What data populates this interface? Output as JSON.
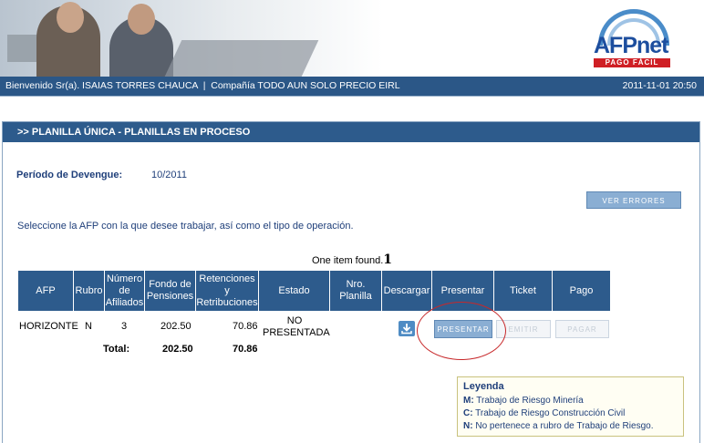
{
  "header": {
    "logo_name": "AFPnet",
    "logo_tagline": "PAGO FÁCIL"
  },
  "userbar": {
    "welcome": "Bienvenido Sr(a). ISAIAS TORRES CHAUCA  |  Compañía TODO AUN SOLO PRECIO EIRL",
    "datetime": "2011-11-01 20:50"
  },
  "panel": {
    "title": ">> PLANILLA ÚNICA - PLANILLAS EN PROCESO"
  },
  "periodo": {
    "label": "Período de Devengue:",
    "value": "10/2011"
  },
  "buttons": {
    "ver_errores": "VER ERRORES",
    "presentar": "PRESENTAR",
    "emitir": "EMITIR",
    "pagar": "PAGAR"
  },
  "instructions": "Seleccione la AFP con la que desee trabajar, así como el tipo de operación.",
  "table": {
    "found_text": "One item found.",
    "page_number": "1",
    "headers": {
      "afp": "AFP",
      "rubro": "Rubro",
      "afiliados": "Número de Afiliados",
      "fondo": "Fondo de Pensiones",
      "retenciones": "Retenciones y Retribuciones",
      "estado": "Estado",
      "planilla": "Nro. Planilla",
      "descargar": "Descargar",
      "presentar": "Presentar",
      "ticket": "Ticket",
      "pago": "Pago"
    },
    "row": {
      "afp": "HORIZONTE",
      "rubro": "N",
      "afiliados": "3",
      "fondo": "202.50",
      "retenciones": "70.86",
      "estado": "NO PRESENTADA"
    },
    "total": {
      "label": "Total:",
      "fondo": "202.50",
      "retenciones": "70.86"
    }
  },
  "legend": {
    "title": "Leyenda",
    "items": [
      {
        "code": "M:",
        "text": "Trabajo de Riesgo Minería"
      },
      {
        "code": "C:",
        "text": "Trabajo de Riesgo Construcción Civil"
      },
      {
        "code": "N:",
        "text": "No pertenece a rubro de Trabajo de Riesgo."
      }
    ]
  },
  "icons": {
    "download": "download-icon"
  },
  "colors": {
    "header_blue": "#2b5787",
    "table_header": "#2d5b8c",
    "button_blue": "#8aaed3",
    "label_blue": "#1f3f7a",
    "highlight_red": "#c7282a",
    "logo_red": "#cf1f25"
  }
}
